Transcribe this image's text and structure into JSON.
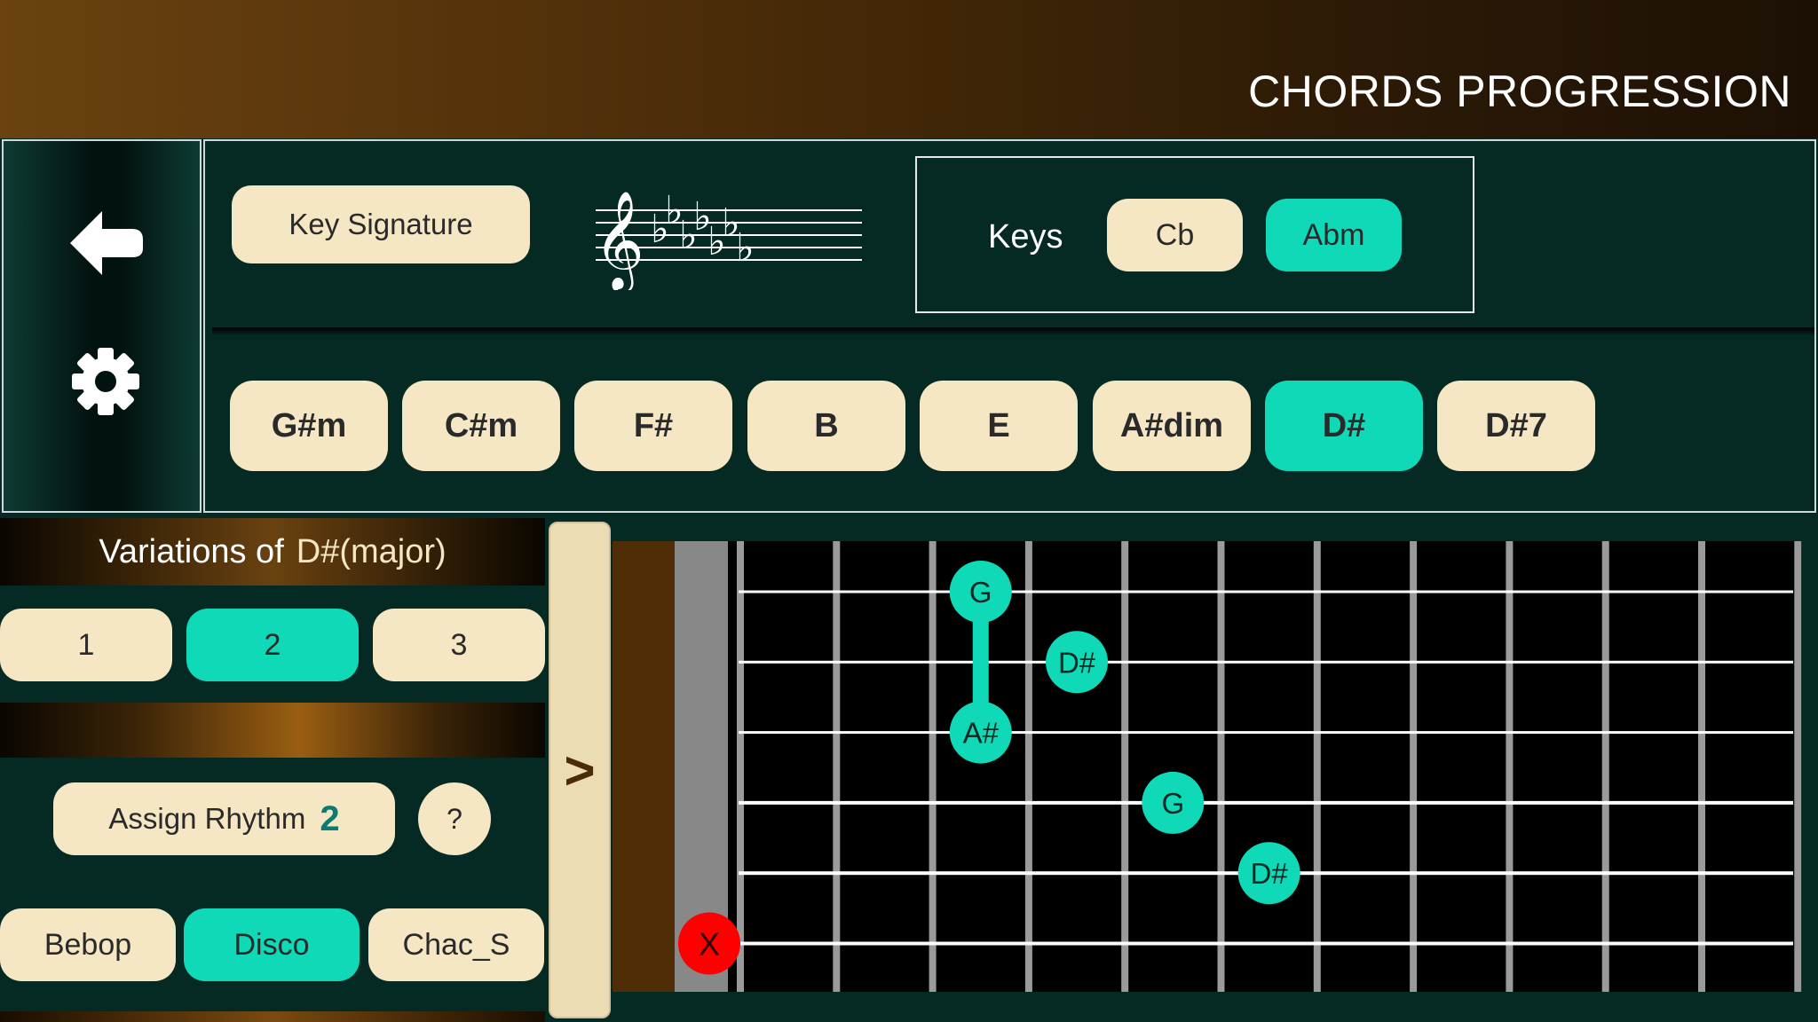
{
  "app": {
    "title": "CHORDS PROGRESSION"
  },
  "side": {
    "back_icon": "back-arrow-icon",
    "settings_icon": "gear-icon"
  },
  "key_signature": {
    "button_label": "Key Signature",
    "flats_count": 7
  },
  "keys": {
    "label": "Keys",
    "options": [
      {
        "label": "Cb",
        "active": false
      },
      {
        "label": "Abm",
        "active": true
      }
    ]
  },
  "chords": [
    {
      "label": "G#m",
      "active": false
    },
    {
      "label": "C#m",
      "active": false
    },
    {
      "label": "F#",
      "active": false
    },
    {
      "label": "B",
      "active": false
    },
    {
      "label": "E",
      "active": false
    },
    {
      "label": "A#dim",
      "active": false
    },
    {
      "label": "D#",
      "active": true
    },
    {
      "label": "D#7",
      "active": false
    }
  ],
  "variations": {
    "title": "Variations of",
    "chord_name": "D#(major)",
    "options": [
      {
        "label": "1",
        "active": false
      },
      {
        "label": "2",
        "active": true
      },
      {
        "label": "3",
        "active": false
      }
    ]
  },
  "rhythm": {
    "assign_label": "Assign Rhythm",
    "assigned_number": "2",
    "help_label": "?"
  },
  "styles": [
    {
      "label": "Bebop",
      "active": false
    },
    {
      "label": "Disco",
      "active": true
    },
    {
      "label": "Chac_S",
      "active": false
    }
  ],
  "expand_label": ">",
  "fretboard": {
    "strings": 6,
    "frets": 12,
    "notes": [
      {
        "string": 1,
        "fret": 3,
        "label": "G"
      },
      {
        "string": 2,
        "fret": 4,
        "label": "D#"
      },
      {
        "string": 3,
        "fret": 3,
        "label": "A#"
      },
      {
        "string": 4,
        "fret": 5,
        "label": "G"
      },
      {
        "string": 5,
        "fret": 6,
        "label": "D#"
      }
    ],
    "barre": {
      "fret": 3,
      "from_string": 1,
      "to_string": 3
    },
    "muted": [
      {
        "string": 6,
        "label": "X"
      }
    ],
    "colors": {
      "note": "#10d9b8",
      "muted": "#ff0000",
      "wood": "#4f2e07",
      "nut": "#888888",
      "fret": "#9a9a9a",
      "string": "#ffffff"
    }
  },
  "colors": {
    "accent": "#10d9b8",
    "pill": "#f5e6c4",
    "panel": "#052a24"
  }
}
